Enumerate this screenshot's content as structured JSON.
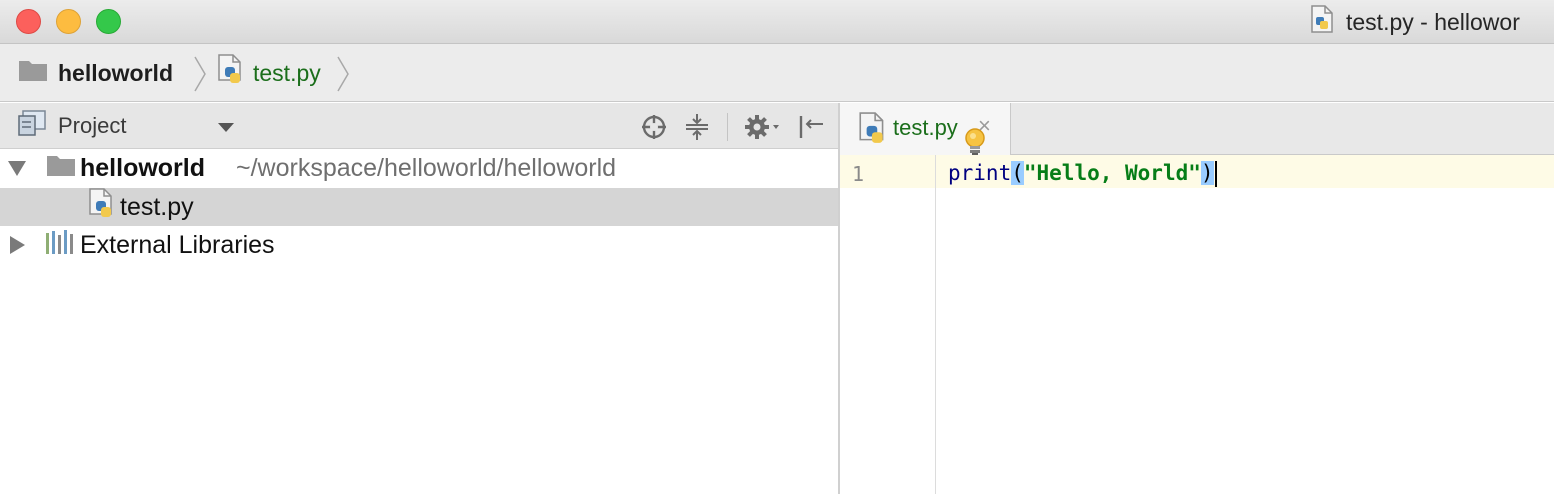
{
  "window": {
    "title": "test.py - hellowor"
  },
  "breadcrumb": {
    "project": "helloworld",
    "file": "test.py"
  },
  "project_panel": {
    "title": "Project",
    "tree": {
      "root_name": "helloworld",
      "root_path": "~/workspace/helloworld/helloworld",
      "file": "test.py",
      "libraries": "External Libraries"
    }
  },
  "editor": {
    "tab_label": "test.py",
    "tab_close": "×",
    "line_number": "1",
    "code": {
      "func": "print",
      "open_paren": "(",
      "string": "\"Hello, World\"",
      "close_paren": ")"
    }
  },
  "colors": {
    "file_green": "#1b6e1b",
    "selection": "#d5d5d5",
    "current_line": "#fefbe6",
    "brace_match": "#99ccff"
  },
  "icons": [
    "folder-icon",
    "python-file-icon",
    "project-view-icon",
    "locate-icon",
    "collapse-icon",
    "gear-icon",
    "hide-icon",
    "library-icon",
    "lightbulb-icon",
    "close-icon"
  ]
}
